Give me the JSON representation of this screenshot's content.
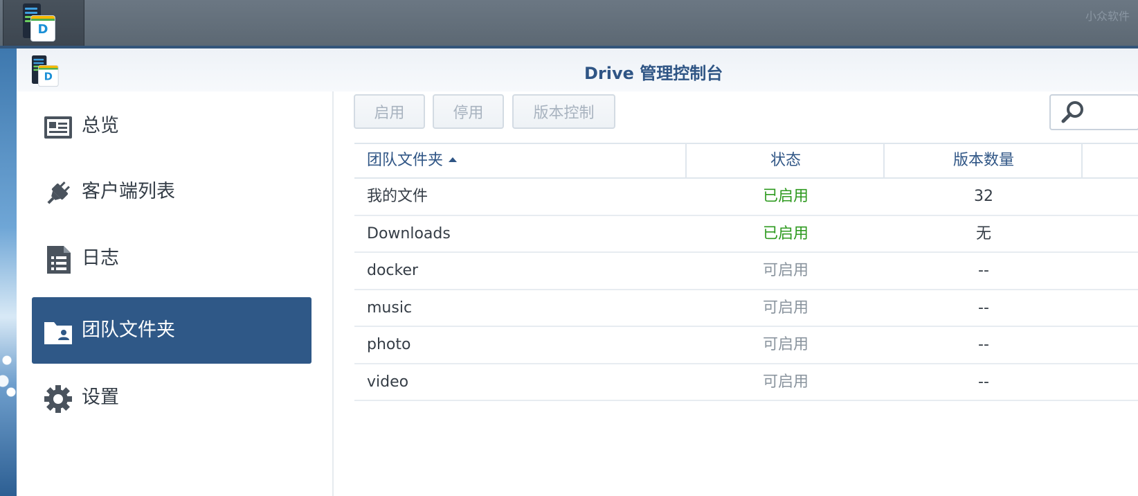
{
  "taskbar": {
    "app_icon": "synology-drive-icon",
    "watermark": "小众软件"
  },
  "window": {
    "title": "Drive 管理控制台",
    "icon": "synology-drive-icon"
  },
  "sidebar": {
    "items": [
      {
        "label": "总览",
        "icon": "overview-card-icon",
        "active": false
      },
      {
        "label": "客户端列表",
        "icon": "plug-icon",
        "active": false
      },
      {
        "label": "日志",
        "icon": "log-document-icon",
        "active": false
      },
      {
        "label": "团队文件夹",
        "icon": "team-folder-icon",
        "active": true
      },
      {
        "label": "设置",
        "icon": "gear-icon",
        "active": false
      }
    ]
  },
  "toolbar": {
    "enable_label": "启用",
    "disable_label": "停用",
    "version_control_label": "版本控制",
    "search_icon": "search-icon"
  },
  "table": {
    "columns": {
      "folder": "团队文件夹",
      "status": "状态",
      "versions": "版本数量"
    },
    "sort": {
      "column": "folder",
      "direction": "ascending"
    },
    "rows": [
      {
        "name": "我的文件",
        "status": "已启用",
        "versions": "32"
      },
      {
        "name": "Downloads",
        "status": "已启用",
        "versions": "无"
      },
      {
        "name": "docker",
        "status": "可启用",
        "versions": "--"
      },
      {
        "name": "music",
        "status": "可启用",
        "versions": "--"
      },
      {
        "name": "photo",
        "status": "可启用",
        "versions": "--"
      },
      {
        "name": "video",
        "status": "可启用",
        "versions": "--"
      }
    ]
  },
  "colors": {
    "accent": "#2f5887",
    "title": "#2f5585",
    "status_enabled": "#2e9a1f",
    "status_available": "#8a949e"
  }
}
